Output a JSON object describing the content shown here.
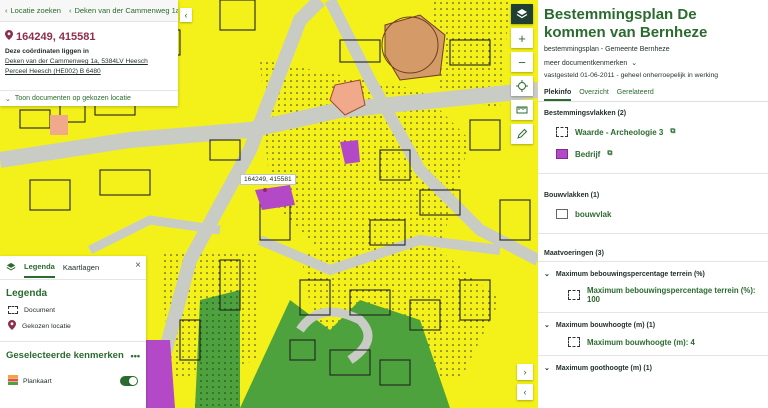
{
  "location": {
    "back_label": "Locatie zoeken",
    "crumb_label": "Deken van der Cammenweg 1a, 5...",
    "coords": "164249, 415581",
    "heading": "Deze coördinaten liggen in",
    "address_link": "Deken van der Cammenweg 1a, 5384LV Heesch",
    "parcel_link": "Perceel Heesch (HE002) B 6480",
    "toggle_label": "Toon documenten op gekozen locatie"
  },
  "map": {
    "marker_label": "164249, 415581"
  },
  "legend": {
    "tabs": [
      "Legenda",
      "Kaartlagen"
    ],
    "title": "Legenda",
    "items": [
      "Document",
      "Gekozen locatie"
    ],
    "selected_title": "Geselecteerde kenmerken",
    "plankaart_label": "Plankaart"
  },
  "panel": {
    "title": "Bestemmingsplan De kommen van Bernheze",
    "subtitle": "bestemmingsplan - Gemeente Bernheze",
    "meta_toggle": "meer documentkenmerken",
    "status": "vastgesteld 01-06-2011 - geheel onherroepelijk in werking",
    "tabs": [
      "Plekinfo",
      "Overzicht",
      "Gerelateerd"
    ],
    "bestemmingsvlakken": {
      "heading": "Bestemmingsvlakken (2)",
      "items": [
        "Waarde - Archeologie 3",
        "Bedrijf"
      ]
    },
    "bouwvlakken": {
      "heading": "Bouwvlakken (1)",
      "items": [
        "bouwvlak"
      ]
    },
    "maatvoeringen": {
      "heading": "Maatvoeringen (3)",
      "groups": [
        {
          "title": "Maximum bebouwingspercentage terrein (%)",
          "value": "Maximum bebouwingspercentage terrein (%): 100"
        },
        {
          "title": "Maximum bouwhoogte (m) (1)",
          "value": "Maximum bouwhoogte (m): 4"
        },
        {
          "title": "Maximum goothoogte (m) (1)",
          "value": ""
        }
      ]
    }
  },
  "colors": {
    "accent": "#2b6b2f",
    "coords": "#8c2f4f",
    "map_yellow": "#f3f119",
    "bedrijf_purple": "#b449c8",
    "green_area": "#4da23e"
  }
}
